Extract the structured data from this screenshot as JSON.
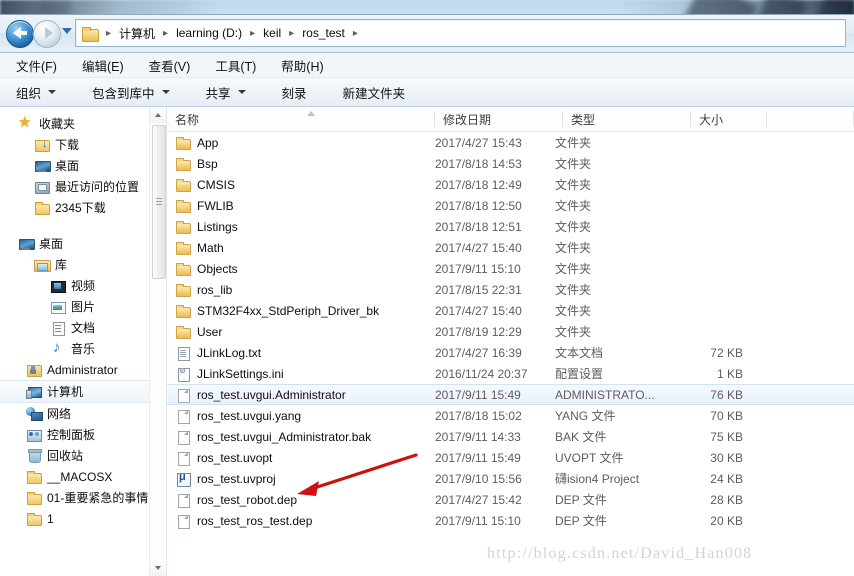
{
  "window": {
    "title": "ros_test"
  },
  "addressbar": {
    "back_label": "后退",
    "forward_label": "前进",
    "history_label": "最近浏览的位置",
    "folder_icon": "folder-icon",
    "breadcrumbs": [
      "计算机",
      "learning (D:)",
      "keil",
      "ros_test"
    ],
    "separator": "▸"
  },
  "menubar": {
    "items": [
      "文件(F)",
      "编辑(E)",
      "查看(V)",
      "工具(T)",
      "帮助(H)"
    ]
  },
  "toolbar": {
    "items": [
      {
        "label": "组织",
        "caret": true
      },
      {
        "label": "包含到库中",
        "caret": true
      },
      {
        "label": "共享",
        "caret": true
      },
      {
        "label": "刻录",
        "caret": false
      },
      {
        "label": "新建文件夹",
        "caret": false
      }
    ]
  },
  "navpane": {
    "groups": [
      {
        "header": {
          "label": "收藏夹",
          "icon": "star-icon",
          "indent": 0
        },
        "items": [
          {
            "label": "下载",
            "icon": "downloads-icon",
            "indent": 1
          },
          {
            "label": "桌面",
            "icon": "desktop-icon",
            "indent": 1
          },
          {
            "label": "最近访问的位置",
            "icon": "recent-places-icon",
            "indent": 1
          },
          {
            "label": "2345下载",
            "icon": "folder-icon",
            "indent": 1
          }
        ]
      },
      {
        "header": {
          "label": "桌面",
          "icon": "desktop-icon",
          "indent": 0
        },
        "items": [
          {
            "label": "库",
            "icon": "library-icon",
            "indent": 1
          },
          {
            "label": "视频",
            "icon": "video-icon",
            "indent": 2
          },
          {
            "label": "图片",
            "icon": "picture-icon",
            "indent": 2
          },
          {
            "label": "文档",
            "icon": "document-icon",
            "indent": 2
          },
          {
            "label": "音乐",
            "icon": "music-icon",
            "indent": 2
          },
          {
            "label": "Administrator",
            "icon": "user-folder-icon",
            "indent": 1
          },
          {
            "label": "计算机",
            "icon": "computer-icon",
            "indent": 1,
            "selected": true
          },
          {
            "label": "网络",
            "icon": "network-icon",
            "indent": 1
          },
          {
            "label": "控制面板",
            "icon": "control-panel-icon",
            "indent": 1
          },
          {
            "label": "回收站",
            "icon": "recycle-bin-icon",
            "indent": 1
          },
          {
            "label": "__MACOSX",
            "icon": "folder-icon",
            "indent": 1
          },
          {
            "label": "01-重要紧急的事情",
            "icon": "folder-icon",
            "indent": 1
          },
          {
            "label": "1",
            "icon": "folder-icon",
            "indent": 1
          }
        ]
      }
    ]
  },
  "filelist": {
    "columns": [
      {
        "id": "name",
        "label": "名称",
        "sorted": "asc"
      },
      {
        "id": "date",
        "label": "修改日期"
      },
      {
        "id": "type",
        "label": "类型"
      },
      {
        "id": "size",
        "label": "大小"
      }
    ],
    "rows": [
      {
        "name": "App",
        "date": "2017/4/27 15:43",
        "type": "文件夹",
        "size": "",
        "icon": "folder-icon"
      },
      {
        "name": "Bsp",
        "date": "2017/8/18 14:53",
        "type": "文件夹",
        "size": "",
        "icon": "folder-icon"
      },
      {
        "name": "CMSIS",
        "date": "2017/8/18 12:49",
        "type": "文件夹",
        "size": "",
        "icon": "folder-icon"
      },
      {
        "name": "FWLIB",
        "date": "2017/8/18 12:50",
        "type": "文件夹",
        "size": "",
        "icon": "folder-icon"
      },
      {
        "name": "Listings",
        "date": "2017/8/18 12:51",
        "type": "文件夹",
        "size": "",
        "icon": "folder-icon"
      },
      {
        "name": "Math",
        "date": "2017/4/27 15:40",
        "type": "文件夹",
        "size": "",
        "icon": "folder-icon"
      },
      {
        "name": "Objects",
        "date": "2017/9/11 15:10",
        "type": "文件夹",
        "size": "",
        "icon": "folder-icon"
      },
      {
        "name": "ros_lib",
        "date": "2017/8/15 22:31",
        "type": "文件夹",
        "size": "",
        "icon": "folder-icon"
      },
      {
        "name": "STM32F4xx_StdPeriph_Driver_bk",
        "date": "2017/4/27 15:40",
        "type": "文件夹",
        "size": "",
        "icon": "folder-icon"
      },
      {
        "name": "User",
        "date": "2017/8/19 12:29",
        "type": "文件夹",
        "size": "",
        "icon": "folder-icon"
      },
      {
        "name": "JLinkLog.txt",
        "date": "2017/4/27 16:39",
        "type": "文本文档",
        "size": "72 KB",
        "icon": "text-file-icon"
      },
      {
        "name": "JLinkSettings.ini",
        "date": "2016/11/24 20:37",
        "type": "配置设置",
        "size": "1 KB",
        "icon": "ini-file-icon"
      },
      {
        "name": "ros_test.uvgui.Administrator",
        "date": "2017/9/11 15:49",
        "type": "ADMINISTRATO...",
        "size": "76 KB",
        "icon": "generic-file-icon",
        "selected": true
      },
      {
        "name": "ros_test.uvgui.yang",
        "date": "2017/8/18 15:02",
        "type": "YANG 文件",
        "size": "70 KB",
        "icon": "generic-file-icon"
      },
      {
        "name": "ros_test.uvgui_Administrator.bak",
        "date": "2017/9/11 14:33",
        "type": "BAK 文件",
        "size": "75 KB",
        "icon": "generic-file-icon"
      },
      {
        "name": "ros_test.uvopt",
        "date": "2017/9/11 15:49",
        "type": "UVOPT 文件",
        "size": "30 KB",
        "icon": "generic-file-icon"
      },
      {
        "name": "ros_test.uvproj",
        "date": "2017/9/10 15:56",
        "type": "礴ision4 Project",
        "size": "24 KB",
        "icon": "uvision-project-icon"
      },
      {
        "name": "ros_test_robot.dep",
        "date": "2017/4/27 15:42",
        "type": "DEP 文件",
        "size": "28 KB",
        "icon": "generic-file-icon"
      },
      {
        "name": "ros_test_ros_test.dep",
        "date": "2017/9/11 15:10",
        "type": "DEP 文件",
        "size": "20 KB",
        "icon": "generic-file-icon"
      }
    ]
  },
  "annotation": {
    "color": "#cc1111",
    "target_row": "ros_test.uvproj"
  },
  "watermark": {
    "text": "http://blog.csdn.net/David_Han008"
  }
}
